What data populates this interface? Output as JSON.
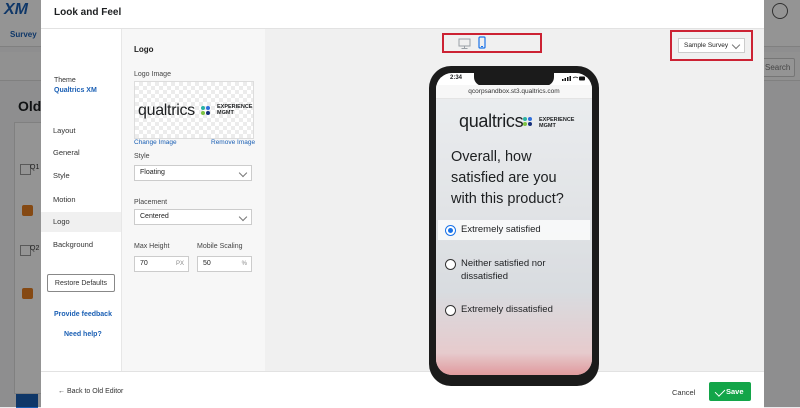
{
  "background": {
    "app_logo": "XM",
    "tab_label": "Survey",
    "search_label": "Search",
    "page_title": "Old, ",
    "q_labels": [
      "Q1",
      "Q2"
    ]
  },
  "modal": {
    "title": "Look and Feel",
    "theme_label": "Theme",
    "theme_value": "Qualtrics XM",
    "nav_items": [
      "Layout",
      "General",
      "Style",
      "Motion",
      "Logo",
      "Background"
    ],
    "active_nav": "Logo",
    "restore_defaults": "Restore Defaults",
    "provide_feedback": "Provide feedback",
    "need_help": "Need help?"
  },
  "settings": {
    "section_title": "Logo",
    "logo_image_label": "Logo Image",
    "logo_text": "qualtrics",
    "logo_xm_line1": "EXPERIENCE",
    "logo_xm_line2": "MGMT",
    "change_image": "Change Image",
    "remove_image": "Remove Image",
    "style_label": "Style",
    "style_value": "Floating",
    "placement_label": "Placement",
    "placement_value": "Centered",
    "max_height_label": "Max Height",
    "max_height_value": "70",
    "max_height_unit": "PX",
    "mobile_scaling_label": "Mobile Scaling",
    "mobile_scaling_value": "50",
    "mobile_scaling_unit": "%"
  },
  "preview": {
    "sample_select": "Sample Survey",
    "device_selected": "mobile",
    "phone_time": "2:34",
    "url": "qcorpsandbox.st3.qualtrics.com",
    "question": "Overall, how satisfied are you with this product?",
    "choices": [
      "Extremely satisfied",
      "Neither satisfied nor dissatisfied",
      "Extremely dissatisfied"
    ],
    "selected_choice": "Extremely satisfied"
  },
  "footer": {
    "back_link": "← Back to Old Editor",
    "cancel": "Cancel",
    "save": "Save"
  },
  "colors": {
    "accent_blue": "#1a5fb4",
    "save_green": "#13a549",
    "highlight_red": "#cc2233",
    "dot_teal": "#2bb3a3",
    "dot_blue": "#2f6fdd",
    "dot_green": "#7cc243",
    "dot_navy": "#16307a"
  }
}
